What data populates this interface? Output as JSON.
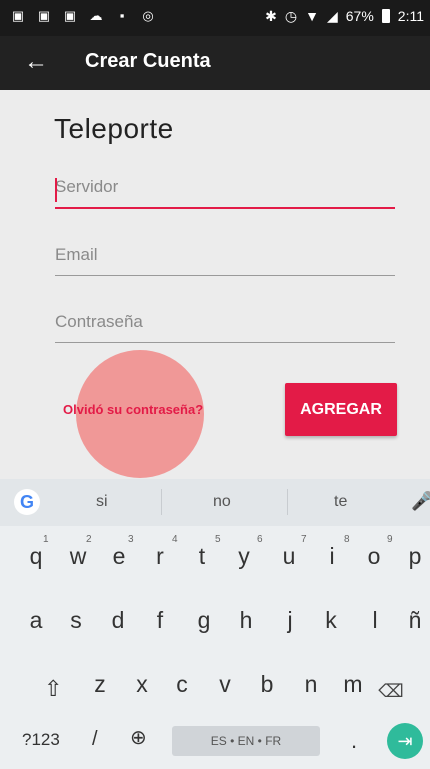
{
  "status_bar": {
    "battery": "67%",
    "time": "2:11",
    "icons": [
      "notification-icon",
      "notification-icon",
      "notification-icon",
      "weather-icon",
      "image-icon",
      "shield-icon",
      "bluetooth-icon",
      "alarm-icon",
      "wifi-icon",
      "signal-icon"
    ]
  },
  "app_bar": {
    "title": "Crear Cuenta"
  },
  "form": {
    "brand": "Teleporte",
    "server_placeholder": "Servidor",
    "email_placeholder": "Email",
    "password_placeholder": "Contraseña",
    "forgot_label": "Olvidó su contraseña?",
    "add_label": "AGREGAR"
  },
  "keyboard": {
    "suggestions": [
      "si",
      "no",
      "te"
    ],
    "row1": [
      "q",
      "w",
      "e",
      "r",
      "t",
      "y",
      "u",
      "i",
      "o",
      "p"
    ],
    "row1_numbers": [
      "1",
      "2",
      "3",
      "4",
      "5",
      "6",
      "7",
      "8",
      "9"
    ],
    "row2": [
      "a",
      "s",
      "d",
      "f",
      "g",
      "h",
      "j",
      "k",
      "l",
      "ñ"
    ],
    "row3": [
      "z",
      "x",
      "c",
      "v",
      "b",
      "n",
      "m"
    ],
    "symbols_label": "?123",
    "slash_label": "/",
    "space_label": "ES • EN • FR",
    "dot_label": "."
  },
  "colors": {
    "accent": "#e31b47",
    "ripple": "#f0908f",
    "enter": "#2fbb9b"
  }
}
